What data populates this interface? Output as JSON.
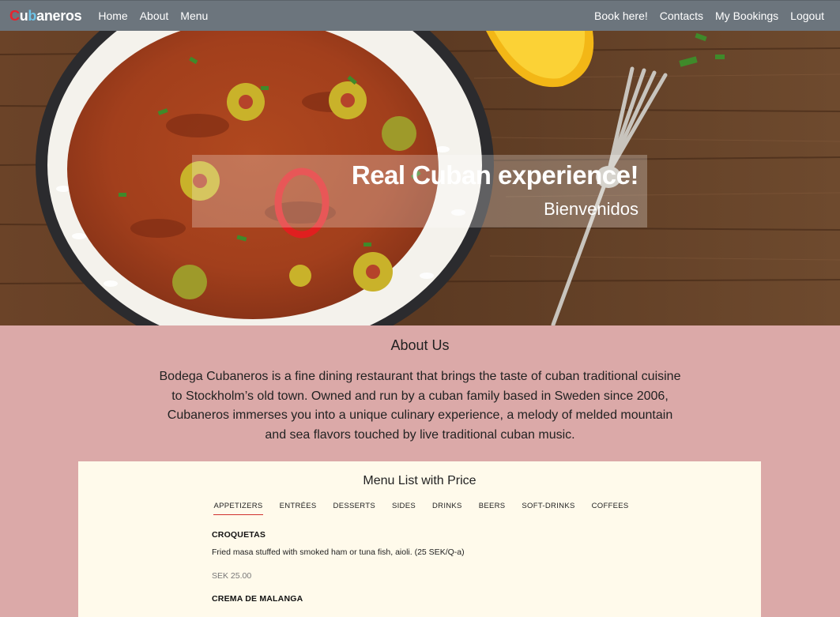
{
  "brand": {
    "part1": "C",
    "part2": "u",
    "part3": "b",
    "part4": "aneros"
  },
  "nav": {
    "left": [
      "Home",
      "About",
      "Menu"
    ],
    "right": [
      "Book here!",
      "Contacts",
      "My Bookings",
      "Logout"
    ]
  },
  "hero": {
    "title": "Real Cuban experience!",
    "subtitle": "Bienvenidos"
  },
  "about": {
    "heading": "About Us",
    "text": "Bodega Cubaneros is a fine dining restaurant that brings the taste of cuban traditional cuisine to Stockholm’s old town. Owned and run by a cuban family based in Sweden since 2006, Cubaneros immerses you into a unique culinary experience, a melody of melded mountain and sea flavors touched by live traditional cuban music."
  },
  "menu": {
    "title": "Menu List with Price",
    "tabs": [
      "APPETIZERS",
      "ENTRÉES",
      "DESSERTS",
      "SIDES",
      "DRINKS",
      "BEERS",
      "SOFT-DRINKS",
      "COFFEES"
    ],
    "items": [
      {
        "name": "CROQUETAS",
        "desc": "Fried masa stuffed with smoked ham or tuna fish, aioli. (25 SEK/Q-a)",
        "price": "SEK 25.00"
      },
      {
        "name": "CREMA DE MALANGA",
        "desc": "",
        "price": ""
      }
    ]
  }
}
